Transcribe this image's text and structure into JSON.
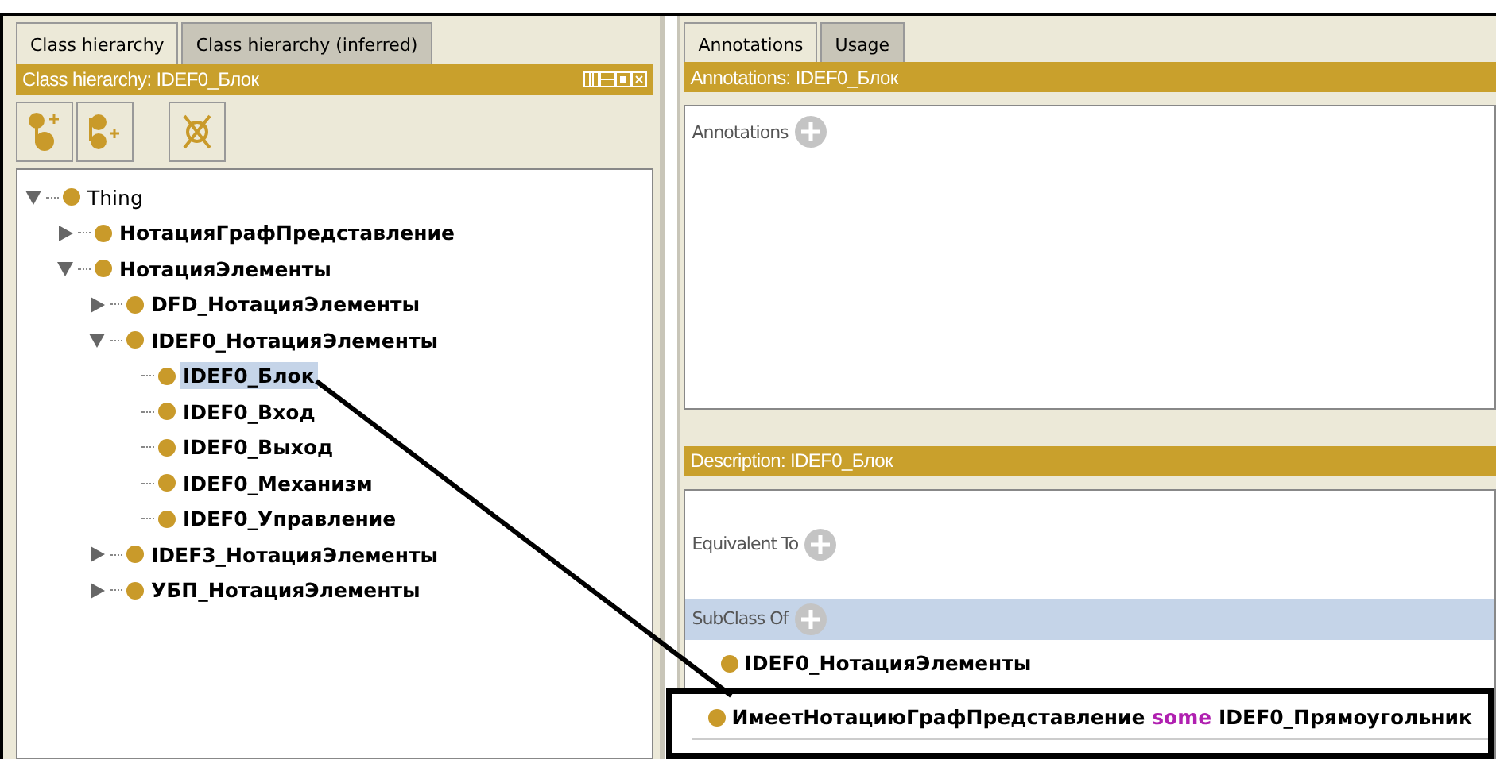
{
  "left_panel": {
    "tabs": [
      {
        "label": "Class hierarchy",
        "selected": true
      },
      {
        "label": "Class hierarchy (inferred)",
        "selected": false
      }
    ],
    "header": "Class hierarchy: IDEF0_Блок",
    "tree": [
      {
        "label": "Thing",
        "selected": false,
        "expanded": true,
        "children": [
          {
            "label": "НотацияГрафПредставление",
            "selected": false,
            "expanded": false
          },
          {
            "label": "НотацияЭлементы",
            "selected": false,
            "expanded": true,
            "children": [
              {
                "label": "DFD_НотацияЭлементы",
                "selected": false,
                "expanded": false
              },
              {
                "label": "IDEF0_НотацияЭлементы",
                "selected": false,
                "expanded": true,
                "children": [
                  {
                    "label": "IDEF0_Блок",
                    "selected": true
                  },
                  {
                    "label": "IDEF0_Вход",
                    "selected": false
                  },
                  {
                    "label": "IDEF0_Выход",
                    "selected": false
                  },
                  {
                    "label": "IDEF0_Механизм",
                    "selected": false
                  },
                  {
                    "label": "IDEF0_Управление",
                    "selected": false
                  }
                ]
              },
              {
                "label": "IDEF3_НотацияЭлементы",
                "selected": false,
                "expanded": false
              },
              {
                "label": "УБП_НотацияЭлементы",
                "selected": false,
                "expanded": false
              }
            ]
          }
        ]
      }
    ]
  },
  "right_panel": {
    "tabs": [
      {
        "label": "Annotations",
        "selected": true
      },
      {
        "label": "Usage",
        "selected": false
      }
    ],
    "annotations_header": "Annotations: IDEF0_Блок",
    "annotations_label": "Annotations",
    "description_header": "Description: IDEF0_Блок",
    "equivalent_label": "Equivalent To",
    "subclass_label": "SubClass Of",
    "subclass_items": [
      {
        "class": "IDEF0_НотацияЭлементы",
        "highlighted": false
      },
      {
        "property": "ИмеетНотациюГрафПредставление",
        "keyword": "some",
        "filler": "IDEF0_Прямоугольник",
        "highlighted": true
      }
    ]
  }
}
